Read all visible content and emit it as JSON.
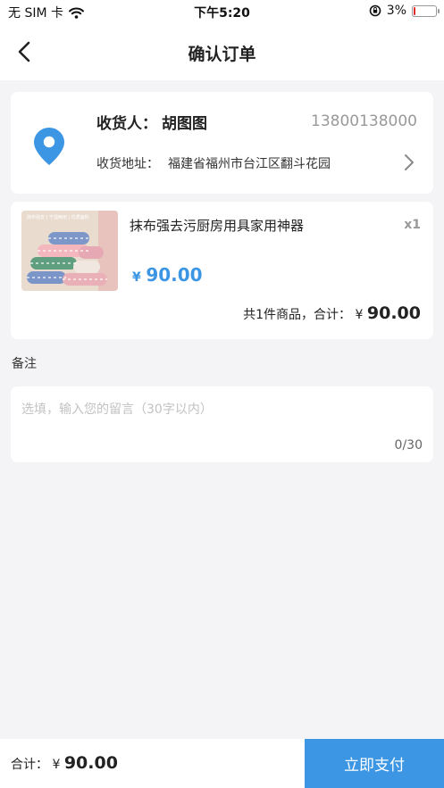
{
  "status_bar": {
    "carrier": "无 SIM 卡",
    "time": "下午5:20",
    "battery_percent": "3%",
    "battery_level": 0.03
  },
  "nav": {
    "title": "确认订单"
  },
  "address": {
    "receiver_label": "收货人：",
    "receiver_name": "胡图图",
    "phone": "13800138000",
    "address_label": "收货地址：",
    "address_value": "福建省福州市台江区翻斗花园"
  },
  "product": {
    "thumb_text": "抹布强去 | 干湿两用 | 优质面料",
    "name": "抹布强去污厨房用具家用神器",
    "quantity": "x1",
    "price_symbol": "¥",
    "price": "90.00",
    "total_prefix": "共1件商品，合计：",
    "total_symbol": "¥",
    "total_amount": "90.00"
  },
  "remark": {
    "label": "备注",
    "placeholder": "选填，输入您的留言（30字以内）",
    "value": "",
    "counter": "0/30"
  },
  "footer": {
    "total_label": "合计：",
    "total_symbol": "¥",
    "total_amount": "90.00",
    "pay_button": "立即支付"
  },
  "colors": {
    "accent": "#3d96e3",
    "background": "#f4f4f6",
    "card": "#ffffff",
    "muted": "#999999"
  },
  "icons": {
    "back": "chevron-left-icon",
    "location": "location-pin-icon",
    "address_arrow": "chevron-right-icon",
    "wifi": "wifi-icon",
    "orientation_lock": "orientation-lock-icon",
    "battery": "battery-icon"
  }
}
